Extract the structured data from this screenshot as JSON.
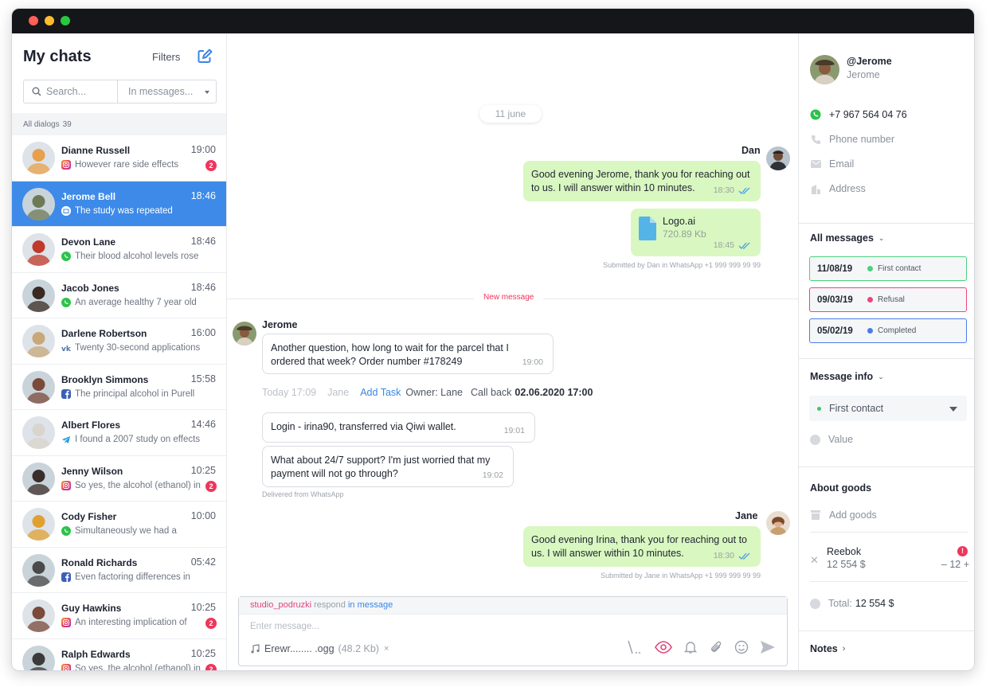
{
  "sidebar": {
    "title": "My chats",
    "filters_label": "Filters",
    "search_placeholder": "Search...",
    "scope_label": "In messages...",
    "all_dialogs_label": "All dialogs",
    "all_dialogs_count": "39",
    "dialogs": [
      {
        "name": "Dianne Russell",
        "time": "19:00",
        "preview": "However rare side effects",
        "source": "instagram",
        "unread": "2",
        "avatar_color": "#e8a04a"
      },
      {
        "name": "Jerome Bell",
        "time": "18:46",
        "preview": "The study was repeated",
        "source": "email",
        "unread": "",
        "avatar_color": "#6d7a55",
        "active": true
      },
      {
        "name": "Devon Lane",
        "time": "18:46",
        "preview": "Their blood alcohol levels rose",
        "source": "whatsapp",
        "unread": "",
        "avatar_color": "#c0392b"
      },
      {
        "name": "Jacob Jones",
        "time": "18:46",
        "preview": "An average healthy 7 year old",
        "source": "whatsapp",
        "unread": "",
        "avatar_color": "#3a2a22"
      },
      {
        "name": "Darlene Robertson",
        "time": "16:00",
        "preview": "Twenty 30-second applications",
        "source": "vk",
        "unread": "",
        "avatar_color": "#c8a878"
      },
      {
        "name": "Brooklyn Simmons",
        "time": "15:58",
        "preview": "The principal alcohol in Purell",
        "source": "facebook",
        "unread": "",
        "avatar_color": "#7a4a3a"
      },
      {
        "name": "Albert Flores",
        "time": "14:46",
        "preview": "I found a 2007 study on effects",
        "source": "telegram",
        "unread": "",
        "avatar_color": "#d9d4cc"
      },
      {
        "name": "Jenny Wilson",
        "time": "10:25",
        "preview": "So yes, the alcohol (ethanol) in",
        "source": "instagram",
        "unread": "2",
        "avatar_color": "#3a2e2a"
      },
      {
        "name": "Cody Fisher",
        "time": "10:00",
        "preview": "Simultaneously we had a",
        "source": "whatsapp",
        "unread": "",
        "avatar_color": "#e0a030"
      },
      {
        "name": "Ronald Richards",
        "time": "05:42",
        "preview": "Even factoring differences in",
        "source": "facebook",
        "unread": "",
        "avatar_color": "#4a4a4a"
      },
      {
        "name": "Guy Hawkins",
        "time": "10:25",
        "preview": "An interesting implication of",
        "source": "instagram",
        "unread": "2",
        "avatar_color": "#7a4a3a"
      },
      {
        "name": "Ralph Edwards",
        "time": "10:25",
        "preview": "So yes, the alcohol (ethanol) in",
        "source": "instagram",
        "unread": "2",
        "avatar_color": "#3a3a3a"
      }
    ]
  },
  "chat": {
    "date_label": "11 june",
    "dan": {
      "name": "Dan",
      "msg1": "Good evening Jerome, thank you for reaching out to us. I will answer within 10 minutes.",
      "msg1_time": "18:30",
      "file_name": "Logo.ai",
      "file_size": "720.89 Kb",
      "file_time": "18:45",
      "submitted": "Submitted by Dan in WhatsApp +1 999 999 99 99"
    },
    "new_message_label": "New message",
    "jerome": {
      "name": "Jerome",
      "msg1": "Another question, how long to wait for the parcel that I ordered that week? Order number #178249",
      "msg1_time": "19:00",
      "msg2": "Login - irina90, transferred via Qiwi wallet.",
      "msg2_time": "19:01",
      "msg3": "What about 24/7 support? I'm just worried that my payment will not go through?",
      "msg3_time": "19:02",
      "delivered": "Delivered from WhatsApp"
    },
    "task": {
      "when": "Today 17:09",
      "who": "Jane",
      "add_task": "Add Task",
      "owner": "Owner: Lane",
      "callback_label": "Call back",
      "callback_value": "02.06.2020 17:00"
    },
    "jane": {
      "name": "Jane",
      "msg1": "Good evening Irina, thank you for reaching out to us. I will answer within 10 minutes.",
      "msg1_time": "18:30",
      "submitted": "Submitted by Jane in WhatsApp +1 999 999 99 99"
    },
    "composer": {
      "reply_user": "studio_podruzki",
      "reply_mid": "respond",
      "reply_target": "in message",
      "placeholder": "Enter message...",
      "attachment_name": "Erewr........ .ogg",
      "attachment_size": "(48.2 Kb)",
      "attachment_remove": "×"
    }
  },
  "contact": {
    "handle": "@Jerome",
    "name": "Jerome",
    "phone_whatsapp": "+7 967 564 04 76",
    "phone_label": "Phone number",
    "email_label": "Email",
    "address_label": "Address",
    "all_messages_label": "All messages",
    "history": [
      {
        "date": "11/08/19",
        "status": "First contact",
        "color": "#4cd07d"
      },
      {
        "date": "09/03/19",
        "status": "Refusal",
        "color": "#f0457a"
      },
      {
        "date": "05/02/19",
        "status": "Completed",
        "color": "#4a7ce8"
      }
    ],
    "message_info_label": "Message info",
    "message_info_value": "First contact",
    "value_label": "Value",
    "about_goods_label": "About goods",
    "add_goods_label": "Add goods",
    "goods": {
      "name": "Reebok",
      "price": "12 554 $",
      "qty": "– 12 +",
      "alert": "!"
    },
    "total_label": "Total:",
    "total_value": "12 554 $",
    "notes_label": "Notes"
  }
}
